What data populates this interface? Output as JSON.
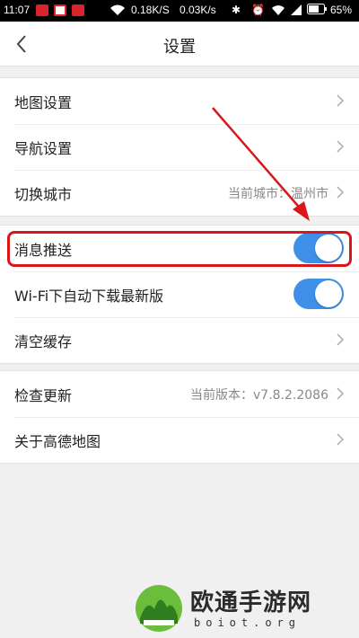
{
  "status_bar": {
    "time": "11:07",
    "net_speed_1": "0.18K/S",
    "net_speed_2": "0.03K/s",
    "battery": "65%",
    "icons": [
      "app-icon-red",
      "camera-icon",
      "mail-icon",
      "wifi-icon",
      "bluetooth-icon",
      "alarm-icon",
      "signal-icon",
      "battery-icon"
    ]
  },
  "header": {
    "title": "设置",
    "back_icon": "chevron-left-icon"
  },
  "groups": [
    {
      "rows": [
        {
          "label": "地图设置",
          "value": "",
          "control": "chevron"
        },
        {
          "label": "导航设置",
          "value": "",
          "control": "chevron"
        },
        {
          "label": "切换城市",
          "value": "当前城市：温州市",
          "control": "chevron"
        }
      ]
    },
    {
      "rows": [
        {
          "label": "消息推送",
          "value": "",
          "control": "toggle",
          "on": true
        },
        {
          "label": "Wi-Fi下自动下载最新版",
          "value": "",
          "control": "toggle",
          "on": true
        },
        {
          "label": "清空缓存",
          "value": "",
          "control": "chevron"
        }
      ]
    },
    {
      "rows": [
        {
          "label": "检查更新",
          "value": "当前版本：v7.8.2.2086",
          "control": "chevron"
        },
        {
          "label": "关于高德地图",
          "value": "",
          "control": "chevron"
        }
      ]
    }
  ],
  "colors": {
    "toggle_on": "#3d8fe8",
    "highlight": "#d9161a"
  },
  "watermark": {
    "title": "欧通手游网",
    "url": "boiot.org"
  }
}
